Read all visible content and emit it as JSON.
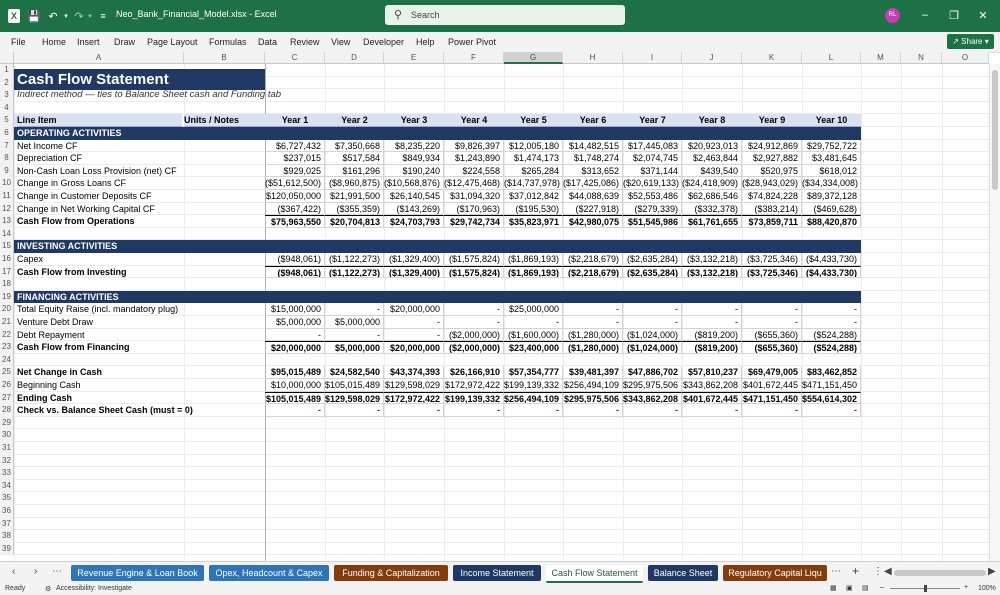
{
  "titlebar": {
    "filename": "Neo_Bank_Financial_Model.xlsx  -  Excel",
    "search_placeholder": "Search",
    "avatar_initials": "RL"
  },
  "menu": [
    "File",
    "Home",
    "Insert",
    "Draw",
    "Page Layout",
    "Formulas",
    "Data",
    "Review",
    "View",
    "Developer",
    "Help",
    "Power Pivot"
  ],
  "share_label": "Share",
  "columns": [
    "A",
    "B",
    "C",
    "D",
    "E",
    "F",
    "G",
    "H",
    "I",
    "J",
    "K",
    "L",
    "M",
    "N",
    "O"
  ],
  "row_numbers": [
    "1",
    "2",
    "3",
    "4",
    "5",
    "6",
    "7",
    "8",
    "9",
    "10",
    "11",
    "12",
    "13",
    "14",
    "15",
    "16",
    "17",
    "18",
    "19",
    "20",
    "21",
    "22",
    "23",
    "24",
    "25",
    "26",
    "27",
    "28",
    "29",
    "30",
    "31",
    "32",
    "33",
    "34",
    "35",
    "36",
    "37",
    "38",
    "39"
  ],
  "sheet": {
    "title": "Cash Flow Statement",
    "subtitle": "Indirect method — ties to Balance Sheet cash and Funding tab",
    "header": {
      "line_item": "Line Item",
      "units": "Units / Notes",
      "years": [
        "Year 1",
        "Year 2",
        "Year 3",
        "Year 4",
        "Year 5",
        "Year 6",
        "Year 7",
        "Year 8",
        "Year 9",
        "Year 10"
      ]
    },
    "sections": {
      "operating": "OPERATING ACTIVITIES",
      "investing": "INVESTING ACTIVITIES",
      "financing": "FINANCING ACTIVITIES"
    },
    "rows": [
      {
        "r": 7,
        "label": "Net Income CF",
        "bold": false,
        "vals": [
          "$6,727,432",
          "$7,350,668",
          "$8,235,220",
          "$9,826,397",
          "$12,005,180",
          "$14,482,515",
          "$17,445,083",
          "$20,923,013",
          "$24,912,869",
          "$29,752,722"
        ]
      },
      {
        "r": 8,
        "label": "Depreciation CF",
        "bold": false,
        "vals": [
          "$237,015",
          "$517,584",
          "$849,934",
          "$1,243,890",
          "$1,474,173",
          "$1,748,274",
          "$2,074,745",
          "$2,463,844",
          "$2,927,882",
          "$3,481,645"
        ]
      },
      {
        "r": 9,
        "label": "Non-Cash Loan Loss Provision (net) CF",
        "bold": false,
        "vals": [
          "$929,025",
          "$161,296",
          "$190,240",
          "$224,558",
          "$265,284",
          "$313,652",
          "$371,144",
          "$439,540",
          "$520,975",
          "$618,012"
        ]
      },
      {
        "r": 10,
        "label": "Change in Gross Loans CF",
        "bold": false,
        "vals": [
          "($51,612,500)",
          "($8,960,875)",
          "($10,568,876)",
          "($12,475,468)",
          "($14,737,978)",
          "($17,425,086)",
          "($20,619,133)",
          "($24,418,909)",
          "($28,943,029)",
          "($34,334,008)"
        ]
      },
      {
        "r": 11,
        "label": "Change in Customer Deposits CF",
        "bold": false,
        "vals": [
          "$120,050,000",
          "$21,991,500",
          "$26,140,545",
          "$31,094,320",
          "$37,012,842",
          "$44,088,639",
          "$52,553,486",
          "$62,686,546",
          "$74,824,228",
          "$89,372,128"
        ]
      },
      {
        "r": 12,
        "label": "Change in Net Working Capital CF",
        "bold": false,
        "vals": [
          "($367,422)",
          "($355,359)",
          "($143,269)",
          "($170,963)",
          "($195,530)",
          "($227,918)",
          "($279,339)",
          "($332,378)",
          "($383,214)",
          "($469,628)"
        ]
      },
      {
        "r": 13,
        "label": "Cash Flow from Operations",
        "bold": true,
        "vals": [
          "$75,963,550",
          "$20,704,813",
          "$24,703,793",
          "$29,742,734",
          "$35,823,971",
          "$42,980,075",
          "$51,545,986",
          "$61,761,655",
          "$73,859,711",
          "$88,420,870"
        ]
      },
      {
        "r": 16,
        "label": "Capex",
        "bold": false,
        "vals": [
          "($948,061)",
          "($1,122,273)",
          "($1,329,400)",
          "($1,575,824)",
          "($1,869,193)",
          "($2,218,679)",
          "($2,635,284)",
          "($3,132,218)",
          "($3,725,346)",
          "($4,433,730)"
        ]
      },
      {
        "r": 17,
        "label": "Cash Flow from Investing",
        "bold": true,
        "vals": [
          "($948,061)",
          "($1,122,273)",
          "($1,329,400)",
          "($1,575,824)",
          "($1,869,193)",
          "($2,218,679)",
          "($2,635,284)",
          "($3,132,218)",
          "($3,725,346)",
          "($4,433,730)"
        ]
      },
      {
        "r": 20,
        "label": "Total Equity Raise (incl. mandatory plug)",
        "bold": false,
        "vals": [
          "$15,000,000",
          "-",
          "$20,000,000",
          "-",
          "$25,000,000",
          "-",
          "-",
          "-",
          "-",
          "-"
        ]
      },
      {
        "r": 21,
        "label": "Venture Debt Draw",
        "bold": false,
        "vals": [
          "$5,000,000",
          "$5,000,000",
          "-",
          "-",
          "-",
          "-",
          "-",
          "-",
          "-",
          "-"
        ]
      },
      {
        "r": 22,
        "label": "Debt Repayment",
        "bold": false,
        "vals": [
          "-",
          "-",
          "-",
          "($2,000,000)",
          "($1,600,000)",
          "($1,280,000)",
          "($1,024,000)",
          "($819,200)",
          "($655,360)",
          "($524,288)"
        ]
      },
      {
        "r": 23,
        "label": "Cash Flow from Financing",
        "bold": true,
        "vals": [
          "$20,000,000",
          "$5,000,000",
          "$20,000,000",
          "($2,000,000)",
          "$23,400,000",
          "($1,280,000)",
          "($1,024,000)",
          "($819,200)",
          "($655,360)",
          "($524,288)"
        ]
      },
      {
        "r": 25,
        "label": "Net Change in Cash",
        "bold": true,
        "vals": [
          "$95,015,489",
          "$24,582,540",
          "$43,374,393",
          "$26,166,910",
          "$57,354,777",
          "$39,481,397",
          "$47,886,702",
          "$57,810,237",
          "$69,479,005",
          "$83,462,852"
        ]
      },
      {
        "r": 26,
        "label": "Beginning Cash",
        "bold": false,
        "vals": [
          "$10,000,000",
          "$105,015,489",
          "$129,598,029",
          "$172,972,422",
          "$199,139,332",
          "$256,494,109",
          "$295,975,506",
          "$343,862,208",
          "$401,672,445",
          "$471,151,450"
        ]
      },
      {
        "r": 27,
        "label": "Ending Cash",
        "bold": true,
        "vals": [
          "$105,015,489",
          "$129,598,029",
          "$172,972,422",
          "$199,139,332",
          "$256,494,109",
          "$295,975,506",
          "$343,862,208",
          "$401,672,445",
          "$471,151,450",
          "$554,614,302"
        ]
      },
      {
        "r": 28,
        "label": "Check vs. Balance Sheet Cash (must = 0)",
        "bold": true,
        "vals": [
          "-",
          "-",
          "-",
          "-",
          "-",
          "-",
          "-",
          "-",
          "-",
          "-"
        ]
      }
    ]
  },
  "tabs": [
    {
      "label": "Revenue Engine & Loan Book",
      "color": "#2e75b6",
      "active": false
    },
    {
      "label": "Opex, Headcount & Capex",
      "color": "#2e75b6",
      "active": false
    },
    {
      "label": "Funding & Capitalization",
      "color": "#843c0c",
      "active": false
    },
    {
      "label": "Income Statement",
      "color": "#1f3864",
      "active": false
    },
    {
      "label": "Cash Flow Statement",
      "color": "#ffffff",
      "active": true
    },
    {
      "label": "Balance Sheet",
      "color": "#1f3864",
      "active": false
    },
    {
      "label": "Regulatory Capital Liqu",
      "color": "#843c0c",
      "active": false
    }
  ],
  "status": {
    "ready": "Ready",
    "accessibility": "Accessibility: Investigate",
    "zoom": "100%"
  }
}
